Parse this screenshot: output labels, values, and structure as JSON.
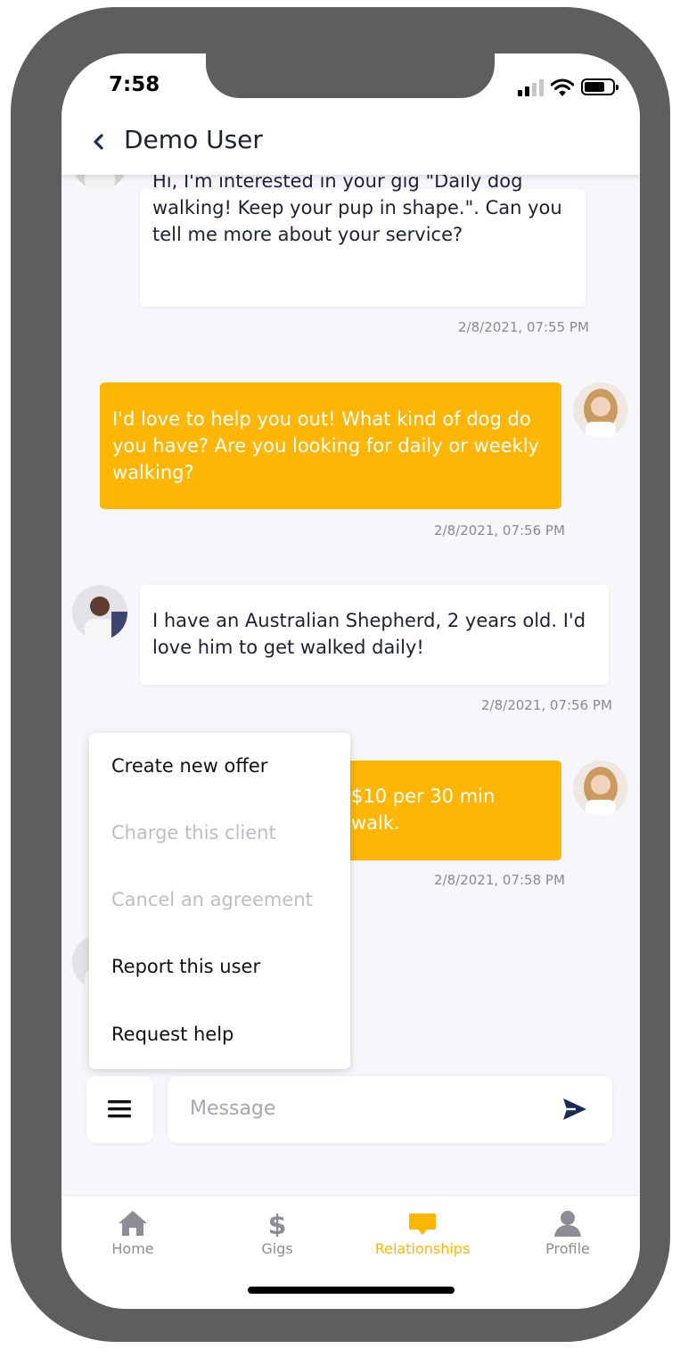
{
  "status_bar": {
    "time": "7:58"
  },
  "header": {
    "title": "Demo User",
    "back_icon": "chevron-left-icon"
  },
  "messages": [
    {
      "direction": "incoming",
      "lines": [
        "Hi, I'm interested in your gig \"Daily dog",
        "walking! Keep your pup in shape.\". Can you",
        "tell me more about your service?"
      ],
      "timestamp": "2/8/2021, 07:55 PM"
    },
    {
      "direction": "outgoing",
      "lines": [
        "I'd love to help you out! What kind of dog do",
        "you have? Are you looking for daily or weekly",
        "walking?"
      ],
      "timestamp": "2/8/2021, 07:56 PM"
    },
    {
      "direction": "incoming",
      "lines": [
        "I have an Australian Shepherd, 2 years old. I'd",
        "love him to get walked daily!"
      ],
      "timestamp": "2/8/2021, 07:56 PM"
    },
    {
      "direction": "outgoing",
      "lines": [
        "$10 per 30 min walk."
      ],
      "timestamp": "2/8/2021, 07:58 PM"
    }
  ],
  "menu": {
    "items": [
      {
        "label": "Create new offer",
        "enabled": true
      },
      {
        "label": "Charge this client",
        "enabled": false
      },
      {
        "label": "Cancel an agreement",
        "enabled": false
      },
      {
        "label": "Report this user",
        "enabled": true
      },
      {
        "label": "Request help",
        "enabled": true
      }
    ]
  },
  "composer": {
    "placeholder": "Message",
    "menu_icon": "hamburger-icon",
    "send_icon": "send-icon"
  },
  "tabs": [
    {
      "label": "Home",
      "icon": "home-icon",
      "active": false
    },
    {
      "label": "Gigs",
      "icon": "dollar-icon",
      "active": false
    },
    {
      "label": "Relationships",
      "icon": "chat-bubble-icon",
      "active": true
    },
    {
      "label": "Profile",
      "icon": "person-icon",
      "active": false
    }
  ],
  "colors": {
    "accent": "#fdb605",
    "text_dark": "#1d2233",
    "chat_background": "#f6f6fb",
    "inactive": "#8d8d95",
    "disabled": "#bdbdc4"
  }
}
